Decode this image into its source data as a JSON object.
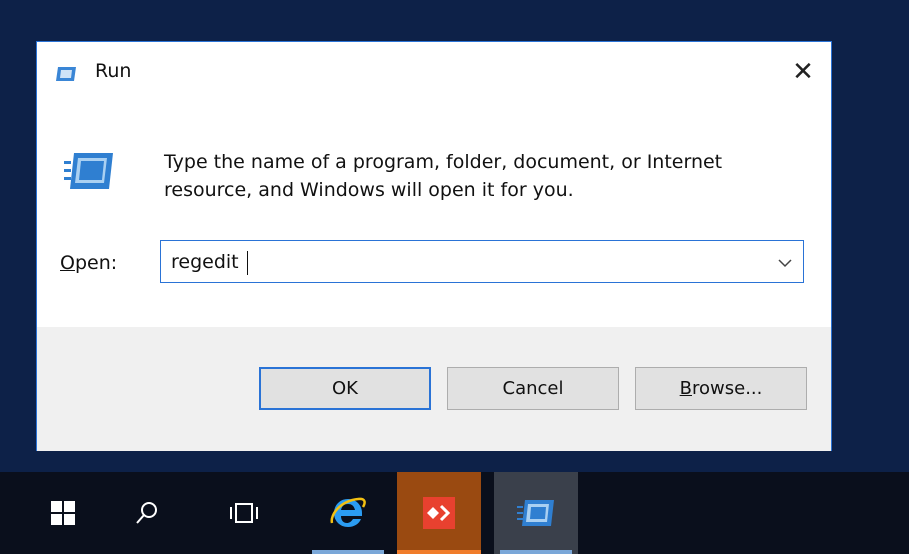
{
  "window": {
    "title": "Run",
    "close_glyph": "✕",
    "message": "Type the name of a program, folder, document, or Internet resource, and Windows will open it for you.",
    "open_label_access": "O",
    "open_label_rest": "pen:",
    "open_value": "regedit",
    "dropdown_glyph": "⌵"
  },
  "buttons": {
    "ok": "OK",
    "cancel": "Cancel",
    "browse_access": "B",
    "browse_rest": "rowse..."
  },
  "taskbar": {
    "items": [
      {
        "name": "start",
        "icon": "windows-logo"
      },
      {
        "name": "search",
        "icon": "search"
      },
      {
        "name": "task-view",
        "icon": "task-view"
      },
      {
        "name": "internet-explorer",
        "icon": "ie"
      },
      {
        "name": "anydesk",
        "icon": "anydesk"
      },
      {
        "name": "run",
        "icon": "run"
      }
    ]
  },
  "colors": {
    "accent": "#2a73d6",
    "anydesk": "#e8412f"
  }
}
